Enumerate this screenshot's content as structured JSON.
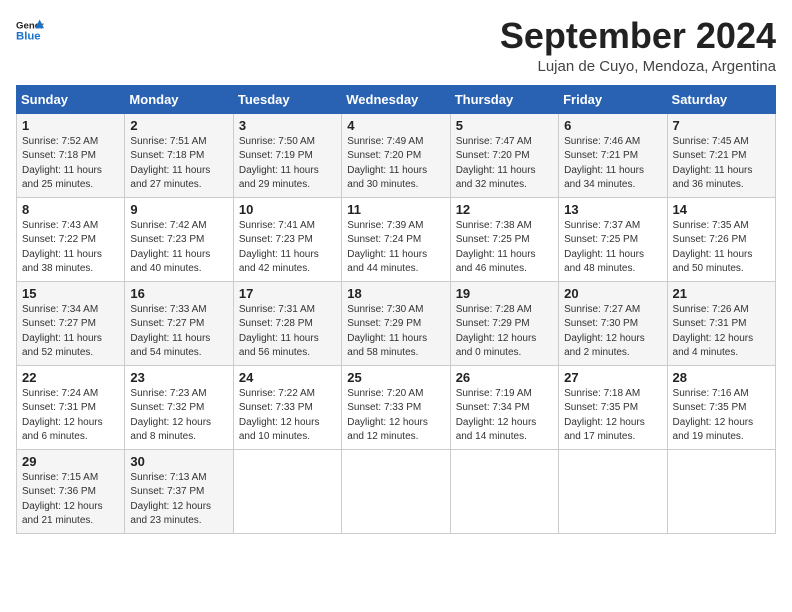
{
  "header": {
    "logo_general": "General",
    "logo_blue": "Blue",
    "month_title": "September 2024",
    "location": "Lujan de Cuyo, Mendoza, Argentina"
  },
  "weekdays": [
    "Sunday",
    "Monday",
    "Tuesday",
    "Wednesday",
    "Thursday",
    "Friday",
    "Saturday"
  ],
  "weeks": [
    [
      {
        "day": "1",
        "sunrise": "7:52 AM",
        "sunset": "7:18 PM",
        "daylight": "11 hours and 25 minutes."
      },
      {
        "day": "2",
        "sunrise": "7:51 AM",
        "sunset": "7:18 PM",
        "daylight": "11 hours and 27 minutes."
      },
      {
        "day": "3",
        "sunrise": "7:50 AM",
        "sunset": "7:19 PM",
        "daylight": "11 hours and 29 minutes."
      },
      {
        "day": "4",
        "sunrise": "7:49 AM",
        "sunset": "7:20 PM",
        "daylight": "11 hours and 30 minutes."
      },
      {
        "day": "5",
        "sunrise": "7:47 AM",
        "sunset": "7:20 PM",
        "daylight": "11 hours and 32 minutes."
      },
      {
        "day": "6",
        "sunrise": "7:46 AM",
        "sunset": "7:21 PM",
        "daylight": "11 hours and 34 minutes."
      },
      {
        "day": "7",
        "sunrise": "7:45 AM",
        "sunset": "7:21 PM",
        "daylight": "11 hours and 36 minutes."
      }
    ],
    [
      {
        "day": "8",
        "sunrise": "7:43 AM",
        "sunset": "7:22 PM",
        "daylight": "11 hours and 38 minutes."
      },
      {
        "day": "9",
        "sunrise": "7:42 AM",
        "sunset": "7:23 PM",
        "daylight": "11 hours and 40 minutes."
      },
      {
        "day": "10",
        "sunrise": "7:41 AM",
        "sunset": "7:23 PM",
        "daylight": "11 hours and 42 minutes."
      },
      {
        "day": "11",
        "sunrise": "7:39 AM",
        "sunset": "7:24 PM",
        "daylight": "11 hours and 44 minutes."
      },
      {
        "day": "12",
        "sunrise": "7:38 AM",
        "sunset": "7:25 PM",
        "daylight": "11 hours and 46 minutes."
      },
      {
        "day": "13",
        "sunrise": "7:37 AM",
        "sunset": "7:25 PM",
        "daylight": "11 hours and 48 minutes."
      },
      {
        "day": "14",
        "sunrise": "7:35 AM",
        "sunset": "7:26 PM",
        "daylight": "11 hours and 50 minutes."
      }
    ],
    [
      {
        "day": "15",
        "sunrise": "7:34 AM",
        "sunset": "7:27 PM",
        "daylight": "11 hours and 52 minutes."
      },
      {
        "day": "16",
        "sunrise": "7:33 AM",
        "sunset": "7:27 PM",
        "daylight": "11 hours and 54 minutes."
      },
      {
        "day": "17",
        "sunrise": "7:31 AM",
        "sunset": "7:28 PM",
        "daylight": "11 hours and 56 minutes."
      },
      {
        "day": "18",
        "sunrise": "7:30 AM",
        "sunset": "7:29 PM",
        "daylight": "11 hours and 58 minutes."
      },
      {
        "day": "19",
        "sunrise": "7:28 AM",
        "sunset": "7:29 PM",
        "daylight": "12 hours and 0 minutes."
      },
      {
        "day": "20",
        "sunrise": "7:27 AM",
        "sunset": "7:30 PM",
        "daylight": "12 hours and 2 minutes."
      },
      {
        "day": "21",
        "sunrise": "7:26 AM",
        "sunset": "7:31 PM",
        "daylight": "12 hours and 4 minutes."
      }
    ],
    [
      {
        "day": "22",
        "sunrise": "7:24 AM",
        "sunset": "7:31 PM",
        "daylight": "12 hours and 6 minutes."
      },
      {
        "day": "23",
        "sunrise": "7:23 AM",
        "sunset": "7:32 PM",
        "daylight": "12 hours and 8 minutes."
      },
      {
        "day": "24",
        "sunrise": "7:22 AM",
        "sunset": "7:33 PM",
        "daylight": "12 hours and 10 minutes."
      },
      {
        "day": "25",
        "sunrise": "7:20 AM",
        "sunset": "7:33 PM",
        "daylight": "12 hours and 12 minutes."
      },
      {
        "day": "26",
        "sunrise": "7:19 AM",
        "sunset": "7:34 PM",
        "daylight": "12 hours and 14 minutes."
      },
      {
        "day": "27",
        "sunrise": "7:18 AM",
        "sunset": "7:35 PM",
        "daylight": "12 hours and 17 minutes."
      },
      {
        "day": "28",
        "sunrise": "7:16 AM",
        "sunset": "7:35 PM",
        "daylight": "12 hours and 19 minutes."
      }
    ],
    [
      {
        "day": "29",
        "sunrise": "7:15 AM",
        "sunset": "7:36 PM",
        "daylight": "12 hours and 21 minutes."
      },
      {
        "day": "30",
        "sunrise": "7:13 AM",
        "sunset": "7:37 PM",
        "daylight": "12 hours and 23 minutes."
      },
      null,
      null,
      null,
      null,
      null
    ]
  ]
}
